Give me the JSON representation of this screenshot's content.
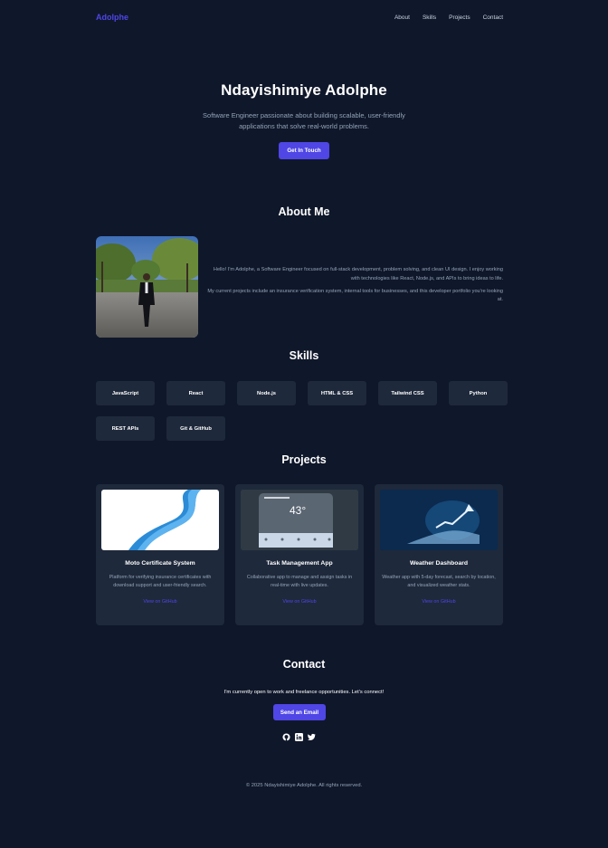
{
  "nav": {
    "brand": "Adolphe",
    "links": [
      "About",
      "Skills",
      "Projects",
      "Contact"
    ]
  },
  "hero": {
    "name": "Ndayishimiye Adolphe",
    "tagline": "Software Engineer passionate about building scalable, user-friendly applications that solve real-world problems.",
    "cta": "Get In Touch"
  },
  "about": {
    "title": "About Me",
    "p1": "Hello! I'm Adolphe, a Software Engineer focused on full-stack development, problem solving, and clean UI design. I enjoy working with technologies like React, Node.js, and APIs to bring ideas to life.",
    "p2": "My current projects include an insurance verification system, internal tools for businesses, and this developer portfolio you're looking at."
  },
  "skills": {
    "title": "Skills",
    "items": [
      "JavaScript",
      "React",
      "Node.js",
      "HTML & CSS",
      "Tailwind CSS",
      "Python",
      "REST APIs",
      "Git & GitHub"
    ]
  },
  "projects": {
    "title": "Projects",
    "items": [
      {
        "title": "Moto Certificate System",
        "desc": "Platform for verifying insurance certificates with download support and user-friendly search.",
        "link": "View on GitHub",
        "icon": "blue-ribbon-image"
      },
      {
        "title": "Task Management App",
        "desc": "Collaborative app to manage and assign tasks in real-time with live updates.",
        "link": "View on GitHub",
        "icon": "weather-widget-image",
        "widget_temp": "43°"
      },
      {
        "title": "Weather Dashboard",
        "desc": "Weather app with 5-day forecast, search by location, and visualized weather stats.",
        "link": "View on GitHub",
        "icon": "hand-growth-chart-image"
      }
    ]
  },
  "contact": {
    "title": "Contact",
    "text": "I'm currently open to work and freelance opportunities. Let's connect!",
    "cta": "Send an Email",
    "social": [
      "github-icon",
      "linkedin-icon",
      "twitter-icon"
    ]
  },
  "footer": {
    "text": "© 2025 Ndayishimiye Adolphe. All rights reserved."
  },
  "colors": {
    "background": "#0f172a",
    "card": "#1e293b",
    "accent": "#4f46e5",
    "muted": "#94a3b8"
  }
}
